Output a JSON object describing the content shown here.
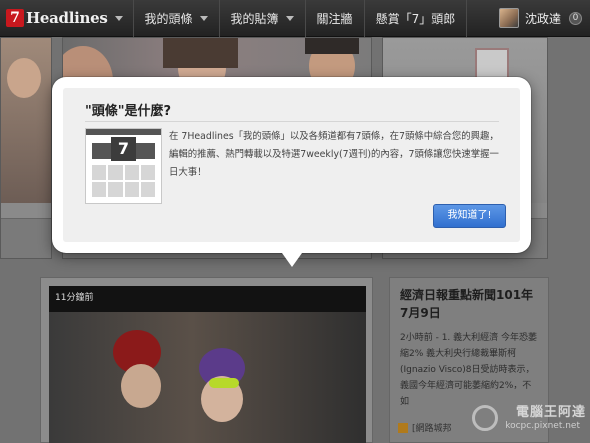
{
  "nav": {
    "brand_mark": "7",
    "brand_name": "Headlines",
    "items": [
      {
        "label": "我的頭條"
      },
      {
        "label": "我的貼簿"
      },
      {
        "label": "關注牆"
      },
      {
        "label": "懸賞「7」頭郎"
      }
    ],
    "user_name": "沈政達",
    "notification_count": "0"
  },
  "background": {
    "video_time": "11分鐘前",
    "side_title": "經濟日報重點新聞101年7月9日",
    "side_body": "2小時前 - 1. 義大利經濟 今年恐萎縮2% 義大利央行總裁畢斯柯(Ignazio Visco)8日受訪時表示，義國今年經濟可能萎縮約2%，不如",
    "side_source": "[網路城邦",
    "watermark": "電腦王阿達",
    "watermark_url": "kocpc.pixnet.net"
  },
  "modal": {
    "title": "\"頭條\"是什麼?",
    "calendar_number": "7",
    "body": "在 7Headlines「我的頭條」以及各頻道都有7頭條，在7頭條中綜合您的興趣，編輯的推薦、熱門轉載以及特選7weekly(7週刊)的內容，7頭條讓您快速掌握一日大事！",
    "ok_label": "我知道了!"
  },
  "colors": {
    "brand_red": "#c8181e",
    "button_blue": "#3f7fd9",
    "navbar": "#2a2a2a"
  }
}
